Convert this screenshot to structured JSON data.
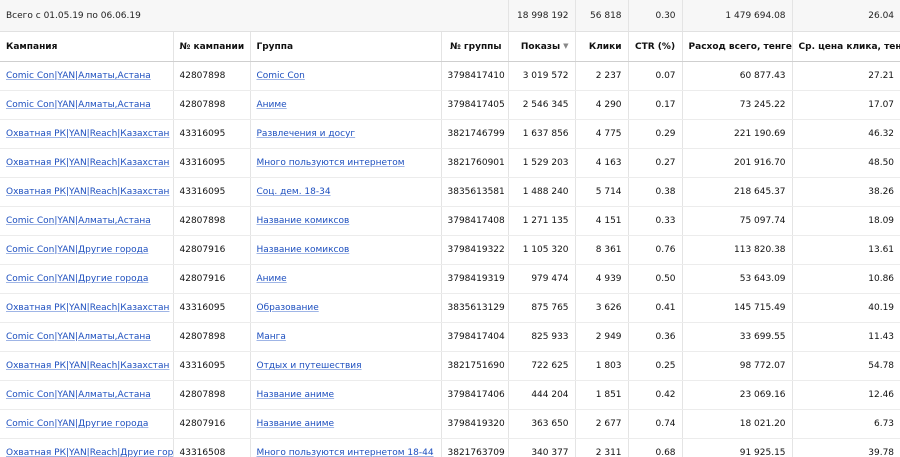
{
  "totals": {
    "period": "Всего с 01.05.19 по 06.06.19",
    "impressions": "18 998 192",
    "clicks": "56 818",
    "ctr": "0.30",
    "spend": "1 479 694.08",
    "cpc": "26.04"
  },
  "columns": {
    "campaign": "Кампания",
    "campaign_no": "№ кампании",
    "group": "Группа",
    "group_no": "№ группы",
    "impressions": "Показы",
    "clicks": "Клики",
    "ctr": "CTR (%)",
    "spend": "Расход всего, тенге",
    "cpc": "Ср. цена клика, тенге"
  },
  "sort": {
    "column": "impressions",
    "direction": "descending",
    "icon": "sort-desc-icon"
  },
  "colors": {
    "link": "#1d4fbf",
    "totals_bg": "#f7f7f7",
    "grid": "#e4e4e4"
  },
  "rows": [
    {
      "campaign": "Comic Con|YAN|Алматы,Астана",
      "campaign_no": "42807898",
      "group": "Comic Con",
      "group_no": "3798417410",
      "impressions": "3 019 572",
      "clicks": "2 237",
      "ctr": "0.07",
      "spend": "60 877.43",
      "cpc": "27.21"
    },
    {
      "campaign": "Comic Con|YAN|Алматы,Астана",
      "campaign_no": "42807898",
      "group": "Аниме",
      "group_no": "3798417405",
      "impressions": "2 546 345",
      "clicks": "4 290",
      "ctr": "0.17",
      "spend": "73 245.22",
      "cpc": "17.07"
    },
    {
      "campaign": "Охватная РК|YAN|Reach|Казахстан",
      "campaign_no": "43316095",
      "group": "Развлечения и досуг",
      "group_no": "3821746799",
      "impressions": "1 637 856",
      "clicks": "4 775",
      "ctr": "0.29",
      "spend": "221 190.69",
      "cpc": "46.32"
    },
    {
      "campaign": "Охватная РК|YAN|Reach|Казахстан",
      "campaign_no": "43316095",
      "group": "Много пользуются интернетом",
      "group_no": "3821760901",
      "impressions": "1 529 203",
      "clicks": "4 163",
      "ctr": "0.27",
      "spend": "201 916.70",
      "cpc": "48.50"
    },
    {
      "campaign": "Охватная РК|YAN|Reach|Казахстан",
      "campaign_no": "43316095",
      "group": "Соц. дем. 18-34",
      "group_no": "3835613581",
      "impressions": "1 488 240",
      "clicks": "5 714",
      "ctr": "0.38",
      "spend": "218 645.37",
      "cpc": "38.26"
    },
    {
      "campaign": "Comic Con|YAN|Алматы,Астана",
      "campaign_no": "42807898",
      "group": "Название комиксов",
      "group_no": "3798417408",
      "impressions": "1 271 135",
      "clicks": "4 151",
      "ctr": "0.33",
      "spend": "75 097.74",
      "cpc": "18.09"
    },
    {
      "campaign": "Comic Con|YAN|Другие города",
      "campaign_no": "42807916",
      "group": "Название комиксов",
      "group_no": "3798419322",
      "impressions": "1 105 320",
      "clicks": "8 361",
      "ctr": "0.76",
      "spend": "113 820.38",
      "cpc": "13.61"
    },
    {
      "campaign": "Comic Con|YAN|Другие города",
      "campaign_no": "42807916",
      "group": "Аниме",
      "group_no": "3798419319",
      "impressions": "979 474",
      "clicks": "4 939",
      "ctr": "0.50",
      "spend": "53 643.09",
      "cpc": "10.86"
    },
    {
      "campaign": "Охватная РК|YAN|Reach|Казахстан",
      "campaign_no": "43316095",
      "group": "Образование",
      "group_no": "3835613129",
      "impressions": "875 765",
      "clicks": "3 626",
      "ctr": "0.41",
      "spend": "145 715.49",
      "cpc": "40.19"
    },
    {
      "campaign": "Comic Con|YAN|Алматы,Астана",
      "campaign_no": "42807898",
      "group": "Манга",
      "group_no": "3798417404",
      "impressions": "825 933",
      "clicks": "2 949",
      "ctr": "0.36",
      "spend": "33 699.55",
      "cpc": "11.43"
    },
    {
      "campaign": "Охватная РК|YAN|Reach|Казахстан",
      "campaign_no": "43316095",
      "group": "Отдых и путешествия",
      "group_no": "3821751690",
      "impressions": "722 625",
      "clicks": "1 803",
      "ctr": "0.25",
      "spend": "98 772.07",
      "cpc": "54.78"
    },
    {
      "campaign": "Comic Con|YAN|Алматы,Астана",
      "campaign_no": "42807898",
      "group": "Название аниме",
      "group_no": "3798417406",
      "impressions": "444 204",
      "clicks": "1 851",
      "ctr": "0.42",
      "spend": "23 069.16",
      "cpc": "12.46"
    },
    {
      "campaign": "Comic Con|YAN|Другие города",
      "campaign_no": "42807916",
      "group": "Название аниме",
      "group_no": "3798419320",
      "impressions": "363 650",
      "clicks": "2 677",
      "ctr": "0.74",
      "spend": "18 021.20",
      "cpc": "6.73"
    },
    {
      "campaign": "Охватная РК|YAN|Reach|Другие города",
      "campaign_no": "43316508",
      "group": "Много пользуются интернетом 18-44",
      "group_no": "3821763709",
      "impressions": "340 377",
      "clicks": "2 311",
      "ctr": "0.68",
      "spend": "91 925.15",
      "cpc": "39.78"
    }
  ]
}
